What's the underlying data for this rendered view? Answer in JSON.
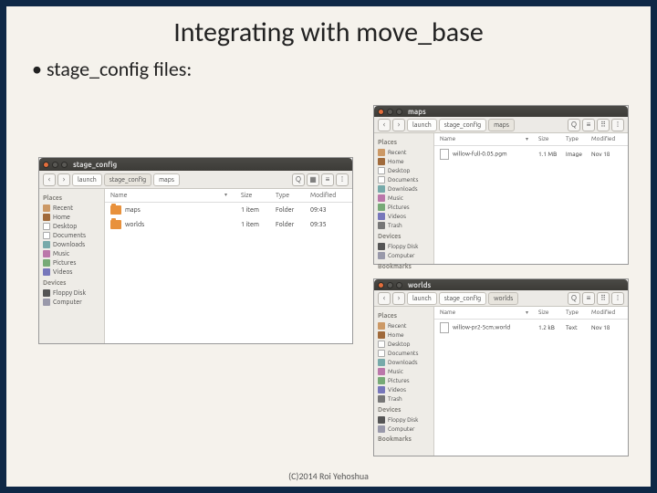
{
  "title": "Integrating with move_base",
  "bullet": "stage_config files:",
  "footer": "(C)2014 Roi Yehoshua",
  "columns": {
    "name": "Name",
    "size": "Size",
    "type": "Type",
    "modified": "Modified"
  },
  "sidebar": {
    "places": "Places",
    "recent": "Recent",
    "home": "Home",
    "desktop": "Desktop",
    "documents": "Documents",
    "downloads": "Downloads",
    "music": "Music",
    "pictures": "Pictures",
    "videos": "Videos",
    "trash": "Trash",
    "devices": "Devices",
    "floppy": "Floppy Disk",
    "computer": "Computer",
    "bookmarks": "Bookmarks"
  },
  "fm1": {
    "win_title": "stage_config",
    "path": [
      "launch",
      "stage_config",
      "maps"
    ],
    "rows": [
      {
        "name": "maps",
        "size": "1 item",
        "type": "Folder",
        "modified": "09:43"
      },
      {
        "name": "worlds",
        "size": "1 item",
        "type": "Folder",
        "modified": "09:35"
      }
    ]
  },
  "fm2": {
    "win_title": "maps",
    "path": [
      "launch",
      "stage_config",
      "maps"
    ],
    "rows": [
      {
        "name": "willow-full-0.05.pgm",
        "size": "1.1 MB",
        "type": "Image",
        "modified": "Nov 18"
      }
    ]
  },
  "fm3": {
    "win_title": "worlds",
    "path": [
      "launch",
      "stage_config",
      "worlds"
    ],
    "rows": [
      {
        "name": "willow-pr2-5cm.world",
        "size": "1.2 kB",
        "type": "Text",
        "modified": "Nov 18"
      }
    ]
  }
}
